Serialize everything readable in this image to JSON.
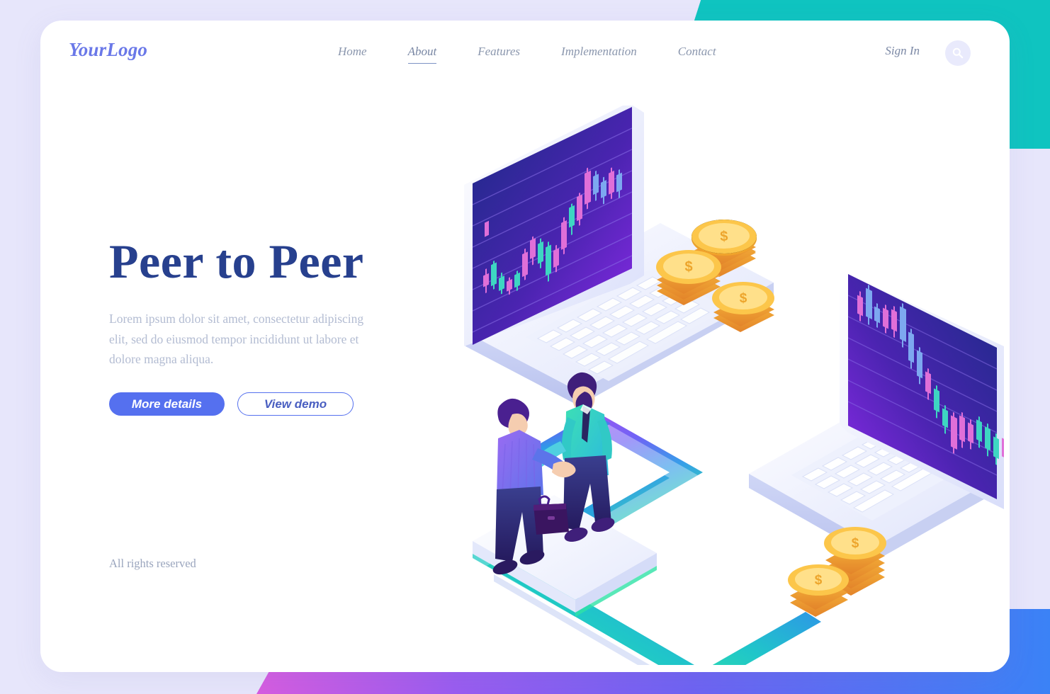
{
  "brand": {
    "logo": "YourLogo"
  },
  "nav": {
    "items": [
      {
        "label": "Home",
        "active": false
      },
      {
        "label": "About",
        "active": true
      },
      {
        "label": "Features",
        "active": false
      },
      {
        "label": "Implementation",
        "active": false
      },
      {
        "label": "Contact",
        "active": false
      }
    ],
    "signin_label": "Sign In",
    "search_icon": "search-icon"
  },
  "hero": {
    "title": "Peer to Peer",
    "subtitle": "Lorem ipsum dolor sit amet, consectetur adipiscing elit, sed do eiusmod tempor incididunt ut labore et dolore magna aliqua.",
    "primary_button": "More details",
    "secondary_button": "View demo"
  },
  "footer": {
    "rights": "All rights reserved"
  },
  "illustration": {
    "alt": "isometric peer to peer trading illustration with two laptops, handshake and gold coins",
    "elements": [
      "laptop-left-candlestick-chart",
      "laptop-right-candlestick-chart",
      "handshake-businessmen",
      "coin-stack-upper",
      "coin-stack-lower",
      "gradient-arrow-connector"
    ]
  },
  "colors": {
    "page_background": "#e7e6fb",
    "card_background": "#ffffff",
    "corner_teal": "#0fc4c0",
    "corner_gradient_from": "#d65ce0",
    "corner_gradient_to": "#3b82f6",
    "logo": "#6a78e8",
    "nav_text": "#8a96ad",
    "heading": "#27408e",
    "body_text": "#b3bcd2",
    "primary_button": "#5570ef",
    "screen_dark": "#1e2a78",
    "screen_purple": "#7b2ff0",
    "candle_teal": "#3ad6c2",
    "candle_pink": "#f06ed0",
    "candle_blue": "#5aa8f5",
    "coin_gold": "#f7b733",
    "suit_teal": "#35d4bd",
    "suit_purple": "#8a6cf0"
  },
  "chart_data": [
    {
      "type": "candlestick",
      "title": "laptop-left-candlestick-chart",
      "trend": "rising",
      "gridlines": 7,
      "candles": [
        {
          "open": 18,
          "close": 22,
          "high": 30,
          "low": 12,
          "dir": "up"
        },
        {
          "open": 22,
          "close": 20,
          "high": 28,
          "low": 14,
          "dir": "down"
        },
        {
          "open": 20,
          "close": 34,
          "high": 38,
          "low": 16,
          "dir": "up"
        },
        {
          "open": 34,
          "close": 26,
          "high": 36,
          "low": 20,
          "dir": "down"
        },
        {
          "open": 26,
          "close": 21,
          "high": 28,
          "low": 16,
          "dir": "down"
        },
        {
          "open": 21,
          "close": 25,
          "high": 30,
          "low": 17,
          "dir": "up"
        },
        {
          "open": 25,
          "close": 23,
          "high": 29,
          "low": 18,
          "dir": "down"
        },
        {
          "open": 23,
          "close": 36,
          "high": 42,
          "low": 20,
          "dir": "up"
        },
        {
          "open": 36,
          "close": 33,
          "high": 44,
          "low": 28,
          "dir": "down"
        },
        {
          "open": 33,
          "close": 40,
          "high": 48,
          "low": 30,
          "dir": "up"
        },
        {
          "open": 40,
          "close": 30,
          "high": 46,
          "low": 22,
          "dir": "down"
        },
        {
          "open": 30,
          "close": 24,
          "high": 34,
          "low": 14,
          "dir": "down"
        },
        {
          "open": 24,
          "close": 38,
          "high": 44,
          "low": 20,
          "dir": "up"
        },
        {
          "open": 38,
          "close": 32,
          "high": 42,
          "low": 26,
          "dir": "down"
        },
        {
          "open": 32,
          "close": 47,
          "high": 54,
          "low": 28,
          "dir": "up"
        },
        {
          "open": 47,
          "close": 44,
          "high": 56,
          "low": 38,
          "dir": "down"
        },
        {
          "open": 44,
          "close": 58,
          "high": 68,
          "low": 40,
          "dir": "up"
        },
        {
          "open": 58,
          "close": 52,
          "high": 72,
          "low": 46,
          "dir": "down"
        },
        {
          "open": 52,
          "close": 66,
          "high": 82,
          "low": 48,
          "dir": "up"
        },
        {
          "open": 66,
          "close": 60,
          "high": 74,
          "low": 52,
          "dir": "down"
        },
        {
          "open": 60,
          "close": 63,
          "high": 70,
          "low": 54,
          "dir": "up"
        },
        {
          "open": 63,
          "close": 57,
          "high": 68,
          "low": 50,
          "dir": "down"
        },
        {
          "open": 57,
          "close": 62,
          "high": 72,
          "low": 46,
          "dir": "up"
        },
        {
          "open": 62,
          "close": 56,
          "high": 70,
          "low": 50,
          "dir": "down"
        }
      ]
    },
    {
      "type": "candlestick",
      "title": "laptop-right-candlestick-chart",
      "trend": "falling",
      "gridlines": 7,
      "candles": [
        {
          "open": 72,
          "close": 66,
          "high": 80,
          "low": 58,
          "dir": "down"
        },
        {
          "open": 66,
          "close": 76,
          "high": 86,
          "low": 60,
          "dir": "up"
        },
        {
          "open": 76,
          "close": 70,
          "high": 80,
          "low": 64,
          "dir": "down"
        },
        {
          "open": 70,
          "close": 64,
          "high": 78,
          "low": 56,
          "dir": "down"
        },
        {
          "open": 64,
          "close": 72,
          "high": 82,
          "low": 58,
          "dir": "up"
        },
        {
          "open": 72,
          "close": 60,
          "high": 84,
          "low": 52,
          "dir": "down"
        },
        {
          "open": 60,
          "close": 50,
          "high": 66,
          "low": 42,
          "dir": "down"
        },
        {
          "open": 50,
          "close": 44,
          "high": 58,
          "low": 36,
          "dir": "down"
        },
        {
          "open": 44,
          "close": 38,
          "high": 52,
          "low": 30,
          "dir": "down"
        },
        {
          "open": 38,
          "close": 30,
          "high": 44,
          "low": 22,
          "dir": "down"
        },
        {
          "open": 30,
          "close": 34,
          "high": 40,
          "low": 24,
          "dir": "up"
        },
        {
          "open": 34,
          "close": 26,
          "high": 38,
          "low": 18,
          "dir": "down"
        },
        {
          "open": 26,
          "close": 20,
          "high": 32,
          "low": 10,
          "dir": "down"
        },
        {
          "open": 20,
          "close": 28,
          "high": 34,
          "low": 12,
          "dir": "up"
        },
        {
          "open": 28,
          "close": 22,
          "high": 33,
          "low": 16,
          "dir": "down"
        },
        {
          "open": 22,
          "close": 30,
          "high": 38,
          "low": 18,
          "dir": "up"
        },
        {
          "open": 30,
          "close": 25,
          "high": 36,
          "low": 20,
          "dir": "down"
        },
        {
          "open": 25,
          "close": 21,
          "high": 30,
          "low": 14,
          "dir": "down"
        },
        {
          "open": 21,
          "close": 27,
          "high": 34,
          "low": 16,
          "dir": "up"
        },
        {
          "open": 27,
          "close": 23,
          "high": 32,
          "low": 18,
          "dir": "down"
        },
        {
          "open": 23,
          "close": 31,
          "high": 40,
          "low": 19,
          "dir": "up"
        },
        {
          "open": 31,
          "close": 26,
          "high": 36,
          "low": 21,
          "dir": "down"
        },
        {
          "open": 26,
          "close": 33,
          "high": 42,
          "low": 22,
          "dir": "up"
        },
        {
          "open": 33,
          "close": 28,
          "high": 38,
          "low": 24,
          "dir": "down"
        }
      ]
    }
  ]
}
